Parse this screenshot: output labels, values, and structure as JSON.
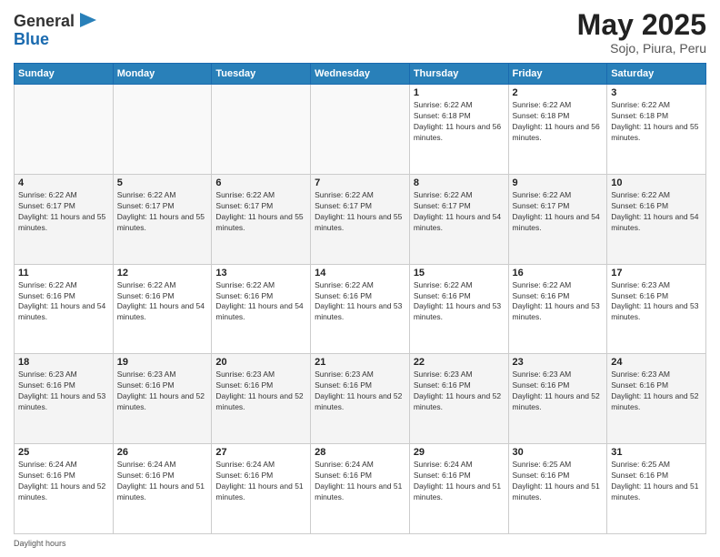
{
  "header": {
    "logo_general": "General",
    "logo_blue": "Blue",
    "title": "May 2025",
    "location": "Sojo, Piura, Peru"
  },
  "calendar": {
    "days_of_week": [
      "Sunday",
      "Monday",
      "Tuesday",
      "Wednesday",
      "Thursday",
      "Friday",
      "Saturday"
    ],
    "weeks": [
      [
        {
          "day": "",
          "info": ""
        },
        {
          "day": "",
          "info": ""
        },
        {
          "day": "",
          "info": ""
        },
        {
          "day": "",
          "info": ""
        },
        {
          "day": "1",
          "info": "Sunrise: 6:22 AM\nSunset: 6:18 PM\nDaylight: 11 hours and 56 minutes."
        },
        {
          "day": "2",
          "info": "Sunrise: 6:22 AM\nSunset: 6:18 PM\nDaylight: 11 hours and 56 minutes."
        },
        {
          "day": "3",
          "info": "Sunrise: 6:22 AM\nSunset: 6:18 PM\nDaylight: 11 hours and 55 minutes."
        }
      ],
      [
        {
          "day": "4",
          "info": "Sunrise: 6:22 AM\nSunset: 6:17 PM\nDaylight: 11 hours and 55 minutes."
        },
        {
          "day": "5",
          "info": "Sunrise: 6:22 AM\nSunset: 6:17 PM\nDaylight: 11 hours and 55 minutes."
        },
        {
          "day": "6",
          "info": "Sunrise: 6:22 AM\nSunset: 6:17 PM\nDaylight: 11 hours and 55 minutes."
        },
        {
          "day": "7",
          "info": "Sunrise: 6:22 AM\nSunset: 6:17 PM\nDaylight: 11 hours and 55 minutes."
        },
        {
          "day": "8",
          "info": "Sunrise: 6:22 AM\nSunset: 6:17 PM\nDaylight: 11 hours and 54 minutes."
        },
        {
          "day": "9",
          "info": "Sunrise: 6:22 AM\nSunset: 6:17 PM\nDaylight: 11 hours and 54 minutes."
        },
        {
          "day": "10",
          "info": "Sunrise: 6:22 AM\nSunset: 6:16 PM\nDaylight: 11 hours and 54 minutes."
        }
      ],
      [
        {
          "day": "11",
          "info": "Sunrise: 6:22 AM\nSunset: 6:16 PM\nDaylight: 11 hours and 54 minutes."
        },
        {
          "day": "12",
          "info": "Sunrise: 6:22 AM\nSunset: 6:16 PM\nDaylight: 11 hours and 54 minutes."
        },
        {
          "day": "13",
          "info": "Sunrise: 6:22 AM\nSunset: 6:16 PM\nDaylight: 11 hours and 54 minutes."
        },
        {
          "day": "14",
          "info": "Sunrise: 6:22 AM\nSunset: 6:16 PM\nDaylight: 11 hours and 53 minutes."
        },
        {
          "day": "15",
          "info": "Sunrise: 6:22 AM\nSunset: 6:16 PM\nDaylight: 11 hours and 53 minutes."
        },
        {
          "day": "16",
          "info": "Sunrise: 6:22 AM\nSunset: 6:16 PM\nDaylight: 11 hours and 53 minutes."
        },
        {
          "day": "17",
          "info": "Sunrise: 6:23 AM\nSunset: 6:16 PM\nDaylight: 11 hours and 53 minutes."
        }
      ],
      [
        {
          "day": "18",
          "info": "Sunrise: 6:23 AM\nSunset: 6:16 PM\nDaylight: 11 hours and 53 minutes."
        },
        {
          "day": "19",
          "info": "Sunrise: 6:23 AM\nSunset: 6:16 PM\nDaylight: 11 hours and 52 minutes."
        },
        {
          "day": "20",
          "info": "Sunrise: 6:23 AM\nSunset: 6:16 PM\nDaylight: 11 hours and 52 minutes."
        },
        {
          "day": "21",
          "info": "Sunrise: 6:23 AM\nSunset: 6:16 PM\nDaylight: 11 hours and 52 minutes."
        },
        {
          "day": "22",
          "info": "Sunrise: 6:23 AM\nSunset: 6:16 PM\nDaylight: 11 hours and 52 minutes."
        },
        {
          "day": "23",
          "info": "Sunrise: 6:23 AM\nSunset: 6:16 PM\nDaylight: 11 hours and 52 minutes."
        },
        {
          "day": "24",
          "info": "Sunrise: 6:23 AM\nSunset: 6:16 PM\nDaylight: 11 hours and 52 minutes."
        }
      ],
      [
        {
          "day": "25",
          "info": "Sunrise: 6:24 AM\nSunset: 6:16 PM\nDaylight: 11 hours and 52 minutes."
        },
        {
          "day": "26",
          "info": "Sunrise: 6:24 AM\nSunset: 6:16 PM\nDaylight: 11 hours and 51 minutes."
        },
        {
          "day": "27",
          "info": "Sunrise: 6:24 AM\nSunset: 6:16 PM\nDaylight: 11 hours and 51 minutes."
        },
        {
          "day": "28",
          "info": "Sunrise: 6:24 AM\nSunset: 6:16 PM\nDaylight: 11 hours and 51 minutes."
        },
        {
          "day": "29",
          "info": "Sunrise: 6:24 AM\nSunset: 6:16 PM\nDaylight: 11 hours and 51 minutes."
        },
        {
          "day": "30",
          "info": "Sunrise: 6:25 AM\nSunset: 6:16 PM\nDaylight: 11 hours and 51 minutes."
        },
        {
          "day": "31",
          "info": "Sunrise: 6:25 AM\nSunset: 6:16 PM\nDaylight: 11 hours and 51 minutes."
        }
      ]
    ]
  },
  "footer": {
    "label": "Daylight hours"
  }
}
